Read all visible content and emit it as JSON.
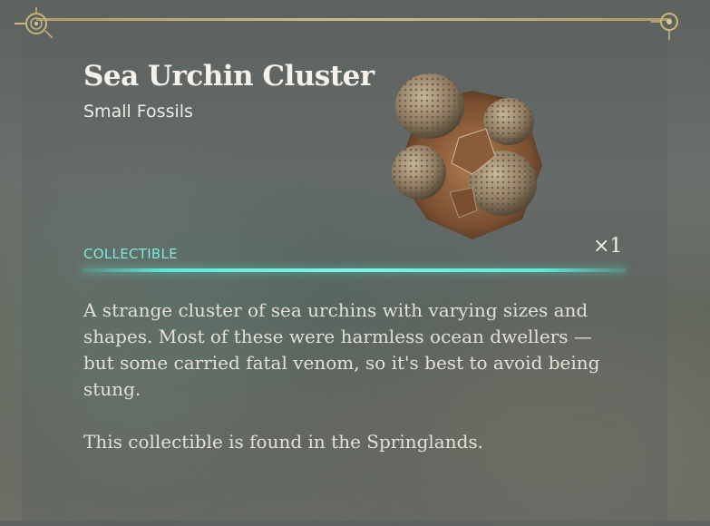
{
  "item": {
    "title": "Sea Urchin Cluster",
    "subtitle": "Small Fossils",
    "image_icon": "sea-urchin-fossil-icon",
    "category": "COLLECTIBLE",
    "count": "×1",
    "description": "A strange cluster of sea urchins with varying sizes and shapes. Most of these were harmless ocean dwellers — but some carried fatal venom, so it's best to avoid being stung.",
    "location": "This collectible is found in the Springlands."
  },
  "colors": {
    "accent": "#7fe9dd",
    "ornament": "#c9b47a",
    "text": "#e2e0d9"
  }
}
